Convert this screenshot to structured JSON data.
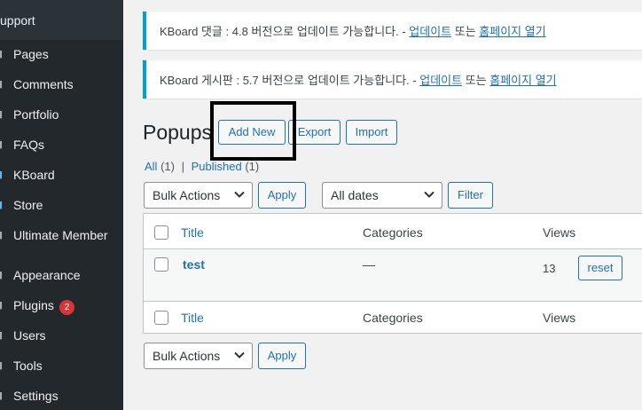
{
  "sidebar": {
    "top_label": "upport",
    "items": [
      {
        "label": "Pages",
        "icon": "pages-icon"
      },
      {
        "label": "Comments",
        "icon": "comments-icon"
      },
      {
        "label": "Portfolio",
        "icon": "portfolio-icon"
      },
      {
        "label": "FAQs",
        "icon": "faqs-icon"
      },
      {
        "label": "KBoard",
        "icon": "kboard-icon"
      },
      {
        "label": "Store",
        "icon": "store-icon"
      },
      {
        "label": "Ultimate Member",
        "icon": "ultimate-member-icon"
      },
      {
        "label": "Appearance",
        "icon": "appearance-icon"
      },
      {
        "label": "Plugins",
        "icon": "plugins-icon",
        "badge": "2"
      },
      {
        "label": "Users",
        "icon": "users-icon"
      },
      {
        "label": "Tools",
        "icon": "tools-icon"
      },
      {
        "label": "Settings",
        "icon": "settings-icon"
      }
    ]
  },
  "notices": [
    {
      "text": "KBoard 댓글 : 4.8 버전으로 업데이트 가능합니다. - ",
      "update_link": "업데이트",
      "or": " 또는 ",
      "homepage_link": "홈페이지 열기"
    },
    {
      "text": "KBoard 게시판 : 5.7 버전으로 업데이트 가능합니다. - ",
      "update_link": "업데이트",
      "or": " 또는 ",
      "homepage_link": "홈페이지 열기"
    }
  ],
  "header": {
    "title": "Popups",
    "add_new": "Add New",
    "export": "Export",
    "import": "Import"
  },
  "filters": {
    "all": "All",
    "all_count": "(1)",
    "sep": "|",
    "published": "Published",
    "published_count": "(1)"
  },
  "top_actions": {
    "bulk_actions": "Bulk Actions",
    "apply": "Apply",
    "all_dates": "All dates",
    "filter": "Filter"
  },
  "table": {
    "columns": [
      "Title",
      "Categories",
      "Views"
    ],
    "rows": [
      {
        "title": "test",
        "categories": "—",
        "views": "13",
        "action": "reset"
      }
    ]
  },
  "bottom_actions": {
    "bulk_actions": "Bulk Actions",
    "apply": "Apply"
  },
  "colors": {
    "accent": "#2271b1",
    "sidebar_bg": "#23282d",
    "notice_border": "#00a0d2",
    "badge": "#d63638"
  }
}
